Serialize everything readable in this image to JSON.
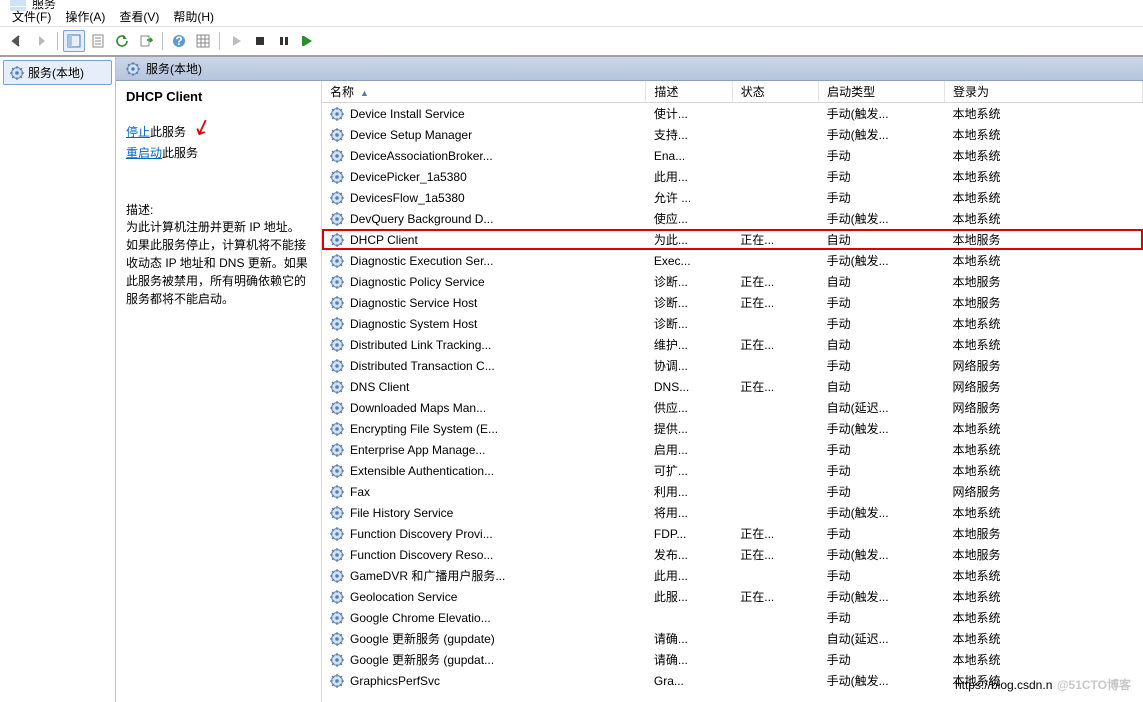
{
  "window": {
    "title": "服务"
  },
  "menu": {
    "file": "文件(F)",
    "action": "操作(A)",
    "view": "查看(V)",
    "help": "帮助(H)"
  },
  "nav": {
    "root": "服务(本地)"
  },
  "tab": {
    "label": "服务(本地)"
  },
  "detail": {
    "title": "DHCP Client",
    "stop_link": "停止",
    "stop_suffix": "此服务",
    "restart_link": "重启动",
    "restart_suffix": "此服务",
    "desc_label": "描述:",
    "desc": "为此计算机注册并更新 IP 地址。如果此服务停止，计算机将不能接收动态 IP 地址和 DNS 更新。如果此服务被禁用，所有明确依赖它的服务都将不能启动。"
  },
  "cols": {
    "name": "名称",
    "desc": "描述",
    "status": "状态",
    "startup": "启动类型",
    "logon": "登录为"
  },
  "colw": {
    "name": 180,
    "desc": 48,
    "status": 48,
    "startup": 70,
    "logon": 110
  },
  "rows": [
    {
      "n": "Device Install Service",
      "d": "使计...",
      "s": "",
      "t": "手动(触发...",
      "l": "本地系统"
    },
    {
      "n": "Device Setup Manager",
      "d": "支持...",
      "s": "",
      "t": "手动(触发...",
      "l": "本地系统"
    },
    {
      "n": "DeviceAssociationBroker...",
      "d": "Ena...",
      "s": "",
      "t": "手动",
      "l": "本地系统"
    },
    {
      "n": "DevicePicker_1a5380",
      "d": "此用...",
      "s": "",
      "t": "手动",
      "l": "本地系统"
    },
    {
      "n": "DevicesFlow_1a5380",
      "d": "允许 ...",
      "s": "",
      "t": "手动",
      "l": "本地系统"
    },
    {
      "n": "DevQuery Background D...",
      "d": "使应...",
      "s": "",
      "t": "手动(触发...",
      "l": "本地系统"
    },
    {
      "n": "DHCP Client",
      "d": "为此...",
      "s": "正在...",
      "t": "自动",
      "l": "本地服务",
      "sel": true
    },
    {
      "n": "Diagnostic Execution Ser...",
      "d": "Exec...",
      "s": "",
      "t": "手动(触发...",
      "l": "本地系统"
    },
    {
      "n": "Diagnostic Policy Service",
      "d": "诊断...",
      "s": "正在...",
      "t": "自动",
      "l": "本地服务"
    },
    {
      "n": "Diagnostic Service Host",
      "d": "诊断...",
      "s": "正在...",
      "t": "手动",
      "l": "本地服务"
    },
    {
      "n": "Diagnostic System Host",
      "d": "诊断...",
      "s": "",
      "t": "手动",
      "l": "本地系统"
    },
    {
      "n": "Distributed Link Tracking...",
      "d": "维护...",
      "s": "正在...",
      "t": "自动",
      "l": "本地系统"
    },
    {
      "n": "Distributed Transaction C...",
      "d": "协调...",
      "s": "",
      "t": "手动",
      "l": "网络服务"
    },
    {
      "n": "DNS Client",
      "d": "DNS...",
      "s": "正在...",
      "t": "自动",
      "l": "网络服务"
    },
    {
      "n": "Downloaded Maps Man...",
      "d": "供应...",
      "s": "",
      "t": "自动(延迟...",
      "l": "网络服务"
    },
    {
      "n": "Encrypting File System (E...",
      "d": "提供...",
      "s": "",
      "t": "手动(触发...",
      "l": "本地系统"
    },
    {
      "n": "Enterprise App Manage...",
      "d": "启用...",
      "s": "",
      "t": "手动",
      "l": "本地系统"
    },
    {
      "n": "Extensible Authentication...",
      "d": "可扩...",
      "s": "",
      "t": "手动",
      "l": "本地系统"
    },
    {
      "n": "Fax",
      "d": "利用...",
      "s": "",
      "t": "手动",
      "l": "网络服务"
    },
    {
      "n": "File History Service",
      "d": "将用...",
      "s": "",
      "t": "手动(触发...",
      "l": "本地系统"
    },
    {
      "n": "Function Discovery Provi...",
      "d": "FDP...",
      "s": "正在...",
      "t": "手动",
      "l": "本地服务"
    },
    {
      "n": "Function Discovery Reso...",
      "d": "发布...",
      "s": "正在...",
      "t": "手动(触发...",
      "l": "本地服务"
    },
    {
      "n": "GameDVR 和广播用户服务...",
      "d": "此用...",
      "s": "",
      "t": "手动",
      "l": "本地系统"
    },
    {
      "n": "Geolocation Service",
      "d": "此服...",
      "s": "正在...",
      "t": "手动(触发...",
      "l": "本地系统"
    },
    {
      "n": "Google Chrome Elevatio...",
      "d": "",
      "s": "",
      "t": "手动",
      "l": "本地系统"
    },
    {
      "n": "Google 更新服务 (gupdate)",
      "d": "请确...",
      "s": "",
      "t": "自动(延迟...",
      "l": "本地系统"
    },
    {
      "n": "Google 更新服务 (gupdat...",
      "d": "请确...",
      "s": "",
      "t": "手动",
      "l": "本地系统"
    },
    {
      "n": "GraphicsPerfSvc",
      "d": "Gra...",
      "s": "",
      "t": "手动(触发...",
      "l": "本地系统"
    }
  ],
  "watermark": {
    "a": "https://blog.csdn.n",
    "b": "@51CTO博客"
  }
}
